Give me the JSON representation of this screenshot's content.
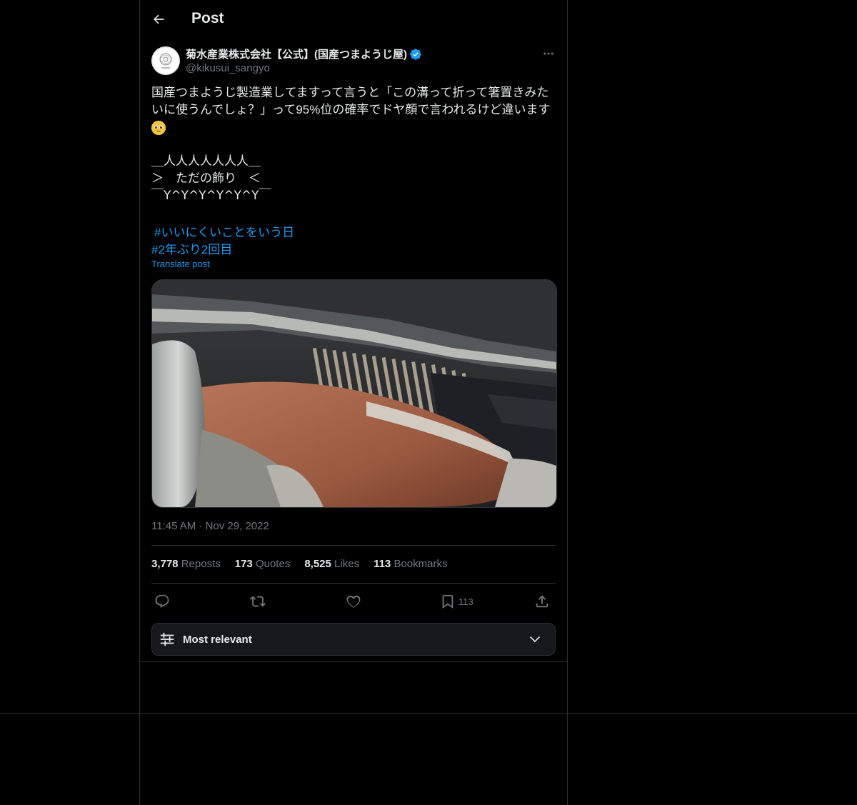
{
  "header": {
    "title": "Post"
  },
  "author": {
    "name": "菊水産業株式会社【公式】(国産つまようじ屋)",
    "handle": "@kikusui_sangyo",
    "verified": true,
    "accent_color": "#1d9bf0"
  },
  "post": {
    "text": "国産つまようじ製造業してますって言うと「この溝って折って箸置きみたいに使うんでしょ？」って95%位の確率でドヤ顔で言われるけど違います",
    "emoji": "pleading-face",
    "ascii_art": [
      "＿人人人人人人人＿",
      "＞　ただの飾り　＜",
      "￣Y^Y^Y^Y^Y^Y￣"
    ],
    "hashtags": [
      "#いいにくいことをいう日",
      "#2年ぶり2回目"
    ],
    "translate_label": "Translate post",
    "timestamp": "11:45 AM · Nov 29, 2022"
  },
  "stats": {
    "reposts": {
      "value": "3,778",
      "label": "Reposts"
    },
    "quotes": {
      "value": "173",
      "label": "Quotes"
    },
    "likes": {
      "value": "8,525",
      "label": "Likes"
    },
    "bookmarks": {
      "value": "113",
      "label": "Bookmarks"
    }
  },
  "actions": {
    "bookmark_count": "113"
  },
  "replies_sort": {
    "label": "Most relevant"
  },
  "icons": [
    "back-arrow-icon",
    "verified-badge-icon",
    "more-icon",
    "reply-icon",
    "repost-icon",
    "like-icon",
    "bookmark-icon",
    "share-icon",
    "sort-sliders-icon",
    "chevron-down-icon"
  ]
}
